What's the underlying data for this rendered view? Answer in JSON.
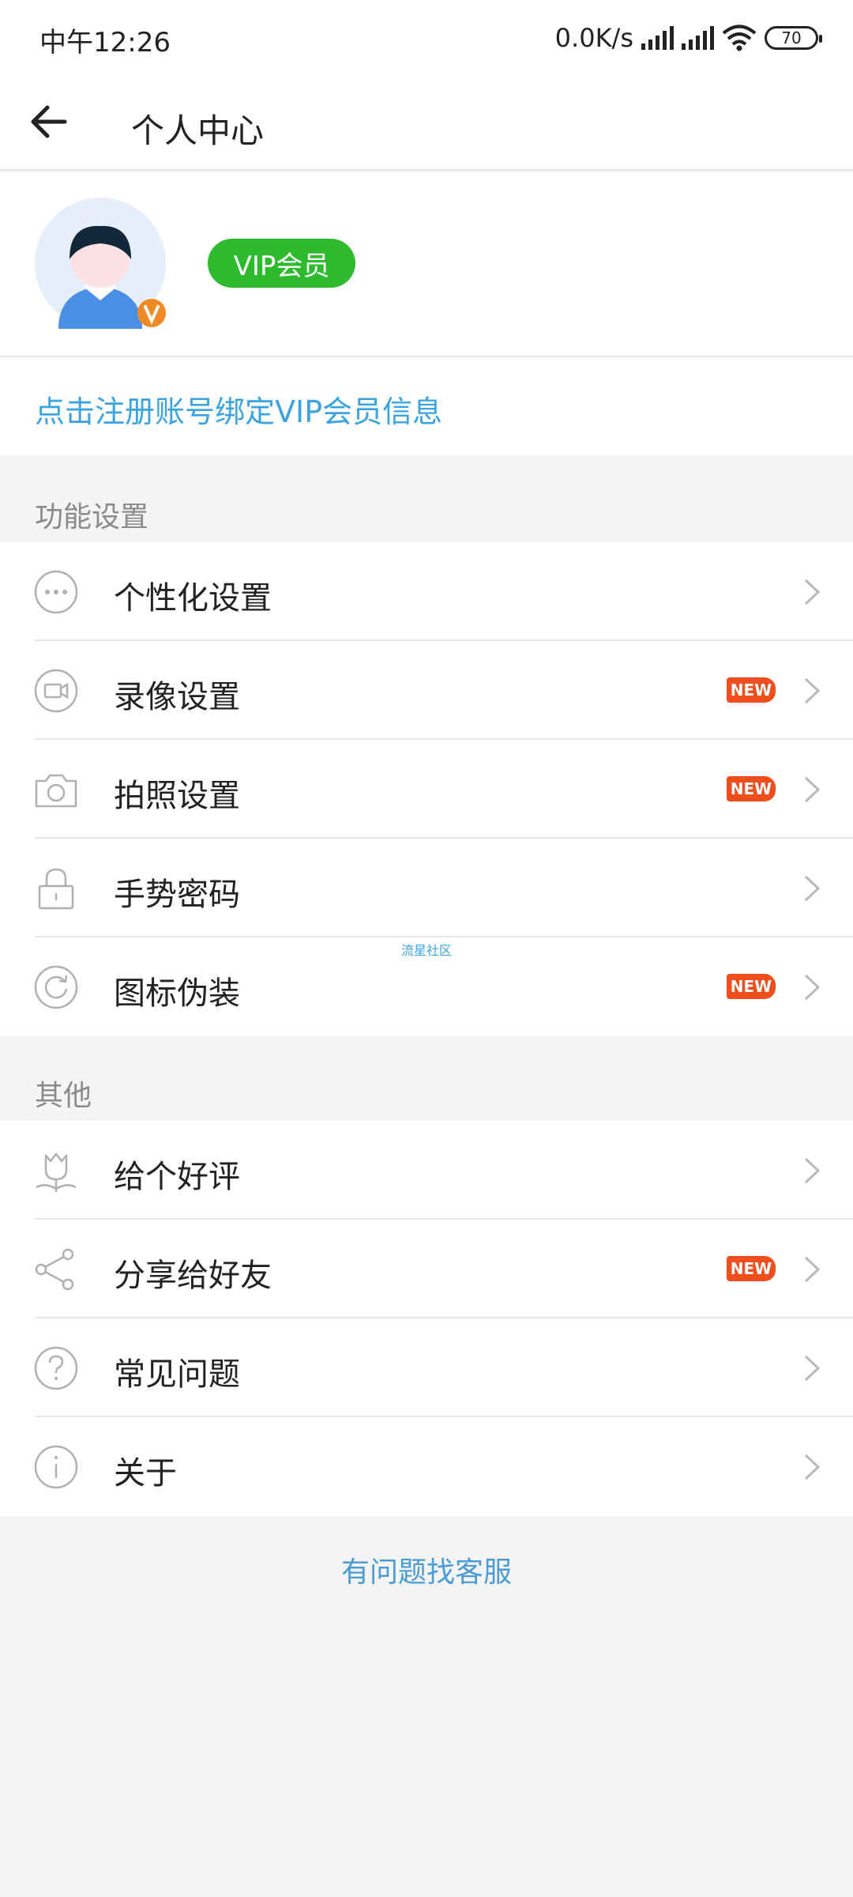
{
  "status_bar": {
    "time": "中午12:26",
    "network_speed": "0.0K/s",
    "battery": "70"
  },
  "header": {
    "back_icon": "back-arrow-icon",
    "title": "个人中心"
  },
  "profile": {
    "avatar_icon": "avatar-icon",
    "vip_badge": "VIP会员",
    "bind_link": "点击注册账号绑定VIP会员信息"
  },
  "sections": {
    "features": {
      "title": "功能设置",
      "items": [
        {
          "label": "个性化设置",
          "icon": "more-dots-icon",
          "new": false
        },
        {
          "label": "录像设置",
          "icon": "video-camera-icon",
          "new": true
        },
        {
          "label": "拍照设置",
          "icon": "camera-icon",
          "new": true
        },
        {
          "label": "手势密码",
          "icon": "lock-icon",
          "new": false
        },
        {
          "label": "图标伪装",
          "icon": "refresh-icon",
          "new": true
        }
      ]
    },
    "others": {
      "title": "其他",
      "items": [
        {
          "label": "给个好评",
          "icon": "flower-icon",
          "new": false
        },
        {
          "label": "分享给好友",
          "icon": "share-icon",
          "new": true
        },
        {
          "label": "常见问题",
          "icon": "question-icon",
          "new": false
        },
        {
          "label": "关于",
          "icon": "info-icon",
          "new": false
        }
      ]
    }
  },
  "new_badge_label": "NEW",
  "watermark": "流星社区",
  "footer": {
    "service_link": "有问题找客服"
  },
  "colors": {
    "accent_blue": "#3ba3e0",
    "vip_green": "#2dbb2d",
    "new_badge": "#f04e1d"
  }
}
